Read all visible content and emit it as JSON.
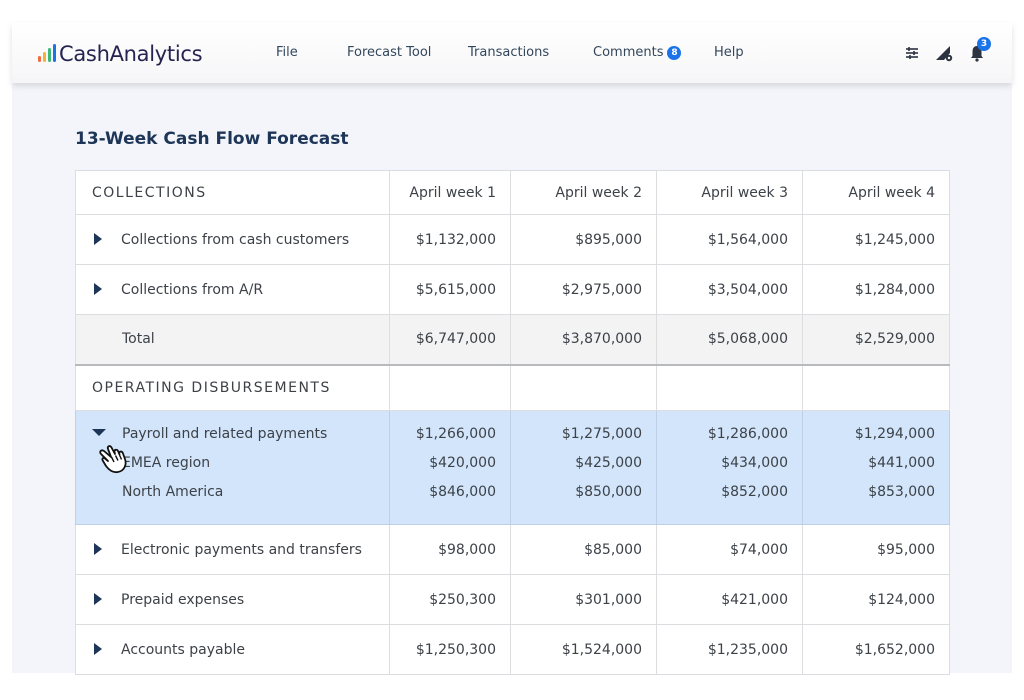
{
  "app": {
    "brand": "CashAnalytics",
    "logo_colors": [
      "#f26b3a",
      "#f5b335",
      "#3cb878",
      "#1a73e8"
    ]
  },
  "nav": {
    "items": [
      {
        "label": "File"
      },
      {
        "label": "Forecast Tool"
      },
      {
        "label": "Transactions"
      },
      {
        "label": "Comments",
        "badge": "8"
      },
      {
        "label": "Help"
      }
    ],
    "notifications_badge": "3",
    "icons": [
      "sliders-icon",
      "signal-settings-icon",
      "bell-icon"
    ]
  },
  "page": {
    "title": "13-Week Cash Flow Forecast"
  },
  "table": {
    "columns": [
      "April week 1",
      "April week 2",
      "April week 3",
      "April week 4"
    ],
    "sections": {
      "collections": "COLLECTIONS",
      "operating": "OPERATING DISBURSEMENTS"
    },
    "collections_rows": [
      {
        "label": "Collections from cash customers",
        "values": [
          "$1,132,000",
          "$895,000",
          "$1,564,000",
          "$1,245,000"
        ]
      },
      {
        "label": "Collections from A/R",
        "values": [
          "$5,615,000",
          "$2,975,000",
          "$3,504,000",
          "$1,284,000"
        ]
      }
    ],
    "total": {
      "label": "Total",
      "values": [
        "$6,747,000",
        "$3,870,000",
        "$5,068,000",
        "$2,529,000"
      ]
    },
    "payroll": {
      "label": "Payroll and related payments",
      "values": [
        "$1,266,000",
        "$1,275,000",
        "$1,286,000",
        "$1,294,000"
      ],
      "children": [
        {
          "label": "EMEA region",
          "values": [
            "$420,000",
            "$425,000",
            "$434,000",
            "$441,000"
          ]
        },
        {
          "label": "North America",
          "values": [
            "$846,000",
            "$850,000",
            "$852,000",
            "$853,000"
          ]
        }
      ]
    },
    "operating_rows": [
      {
        "label": "Electronic payments and transfers",
        "values": [
          "$98,000",
          "$85,000",
          "$74,000",
          "$95,000"
        ]
      },
      {
        "label": "Prepaid expenses",
        "values": [
          "$250,300",
          "$301,000",
          "$421,000",
          "$124,000"
        ]
      },
      {
        "label": "Accounts payable",
        "values": [
          "$1,250,300",
          "$1,524,000",
          "$1,235,000",
          "$1,652,000"
        ]
      }
    ]
  },
  "colors": {
    "accent": "#1a73e8",
    "navy": "#1d3557",
    "highlight_row": "#d2e5fb"
  }
}
